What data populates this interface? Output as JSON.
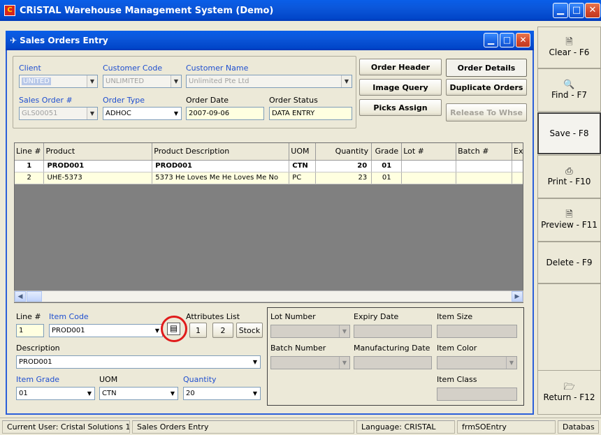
{
  "app": {
    "title": "CRiSTAL Warehouse Management System (Demo)",
    "icon_letter": "C"
  },
  "window_controls": {
    "minimize": "▁",
    "maximize": "□",
    "close": "✕"
  },
  "child_window": {
    "title": "Sales Orders Entry"
  },
  "header": {
    "client": {
      "label": "Client",
      "value": "UNITED"
    },
    "customer_code": {
      "label": "Customer Code",
      "value": "UNLIMITED"
    },
    "customer_name": {
      "label": "Customer Name",
      "value": "Unlimited Pte Ltd"
    },
    "sales_order": {
      "label": "Sales Order #",
      "value": "GLS00051"
    },
    "order_type": {
      "label": "Order Type",
      "value": "ADHOC"
    },
    "order_date": {
      "label": "Order Date",
      "value": "2007-09-06"
    },
    "order_status": {
      "label": "Order Status",
      "value": "DATA ENTRY"
    }
  },
  "action_buttons": {
    "order_header": "Order Header",
    "order_details": "Order Details",
    "image_query": "Image Query",
    "duplicate_orders": "Duplicate Orders",
    "picks_assign": "Picks Assign",
    "release_to_whse": "Release To Whse"
  },
  "grid": {
    "columns": [
      "Line #",
      "Product",
      "Product Description",
      "UOM",
      "Quantity",
      "Grade",
      "Lot #",
      "Batch #",
      "Ex"
    ],
    "rows": [
      [
        "1",
        "PROD001",
        "PROD001",
        "CTN",
        "20",
        "01",
        "",
        "",
        ""
      ],
      [
        "2",
        "UHE-5373",
        "5373 He Loves Me He Loves Me No",
        "PC",
        "23",
        "01",
        "",
        "",
        ""
      ]
    ]
  },
  "detail": {
    "line_label": "Line #",
    "line_value": "1",
    "item_code_label": "Item Code",
    "item_code_value": "PROD001",
    "attributes_label": "Attributes List",
    "attr_1": "1",
    "attr_2": "2",
    "stock_label": "Stock",
    "description_label": "Description",
    "description_value": "PROD001",
    "item_grade_label": "Item Grade",
    "item_grade_value": "01",
    "uom_label": "UOM",
    "uom_value": "CTN",
    "quantity_label": "Quantity",
    "quantity_value": "20"
  },
  "lot_panel": {
    "lot_number": "Lot Number",
    "expiry_date": "Expiry Date",
    "item_size": "Item Size",
    "batch_number": "Batch Number",
    "manufacturing_date": "Manufacturing Date",
    "item_color": "Item Color",
    "item_class": "Item Class"
  },
  "sidebar": {
    "clear": {
      "label": "Clear - F6",
      "icon": "new-document-icon"
    },
    "find": {
      "label": "Find - F7",
      "icon": "binoculars-icon"
    },
    "save": {
      "label": "Save - F8"
    },
    "print": {
      "label": "Print - F10",
      "icon": "printer-icon"
    },
    "preview": {
      "label": "Preview - F11",
      "icon": "print-preview-icon"
    },
    "delete": {
      "label": "Delete - F9"
    },
    "return": {
      "label": "Return - F12",
      "icon": "return-folder-icon"
    }
  },
  "status_bar": {
    "user": "Current User: Cristal Solutions 1",
    "screen": "Sales Orders Entry",
    "language": "Language: CRISTAL",
    "form": "frmSOEntry",
    "database": "Databas"
  },
  "colors": {
    "title_bar": "#0A5EE8",
    "label_blue": "#1F4FD0",
    "highlight_yellow": "#FFFFE0",
    "annotation_red": "#E01B1B"
  }
}
